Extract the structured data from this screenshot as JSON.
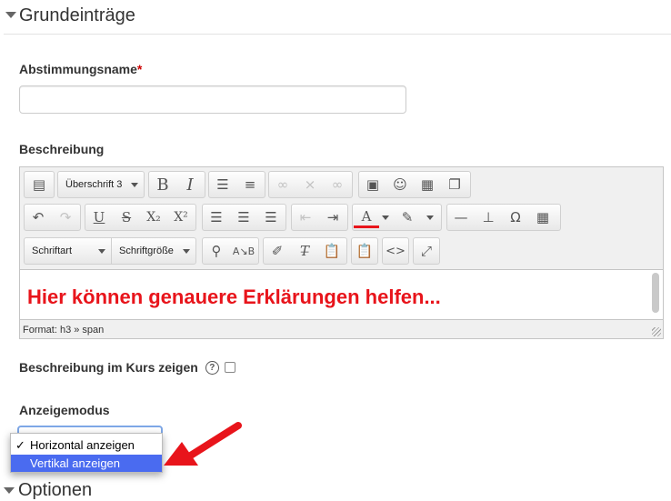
{
  "section": {
    "title": "Grundeinträge"
  },
  "fields": {
    "name_label": "Abstimmungsname",
    "required_mark": "*",
    "name_value": "",
    "description_label": "Beschreibung"
  },
  "editor": {
    "heading_select": "Überschrift 3",
    "font_select": "Schriftart",
    "size_select": "Schriftgröße",
    "content": "Hier können genauere Erklärungen helfen...",
    "status": "Format: h3 » span",
    "content_color": "#e8141b"
  },
  "show_description": {
    "label": "Beschreibung im Kurs zeigen",
    "checked": false,
    "help_icon": "?"
  },
  "display_mode": {
    "label": "Anzeigemodus",
    "options": [
      {
        "label": "Horizontal anzeigen",
        "selected": true,
        "highlighted": false
      },
      {
        "label": "Vertikal anzeigen",
        "selected": false,
        "highlighted": true
      }
    ],
    "check_glyph": "✓"
  },
  "next_section": {
    "title": "Optionen"
  },
  "annotation": {
    "arrow_color": "#e8141b"
  }
}
